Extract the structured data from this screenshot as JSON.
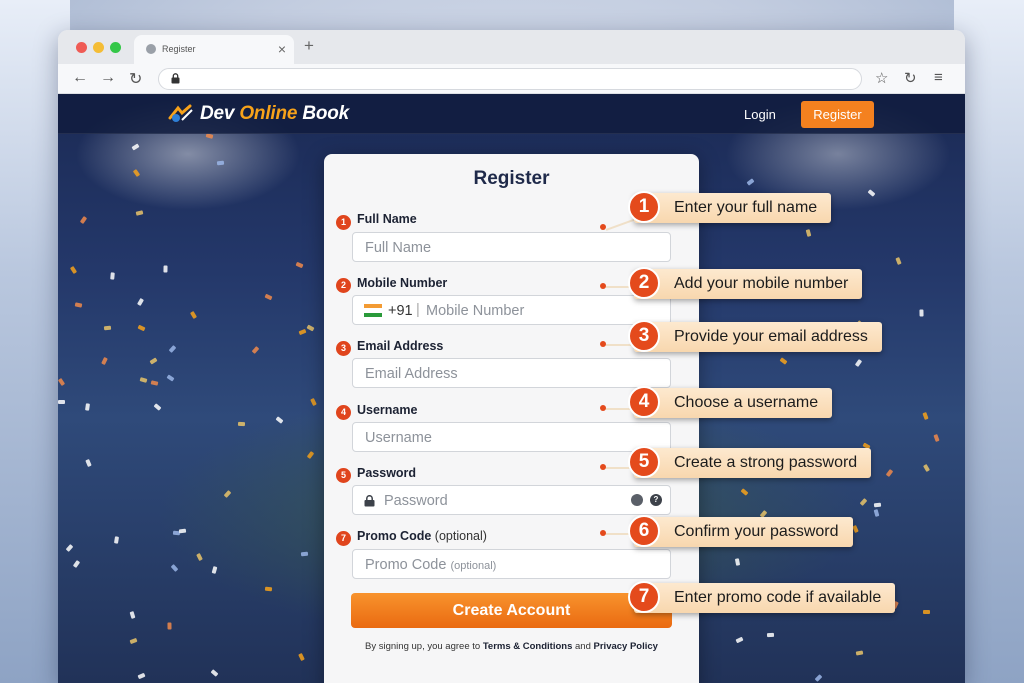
{
  "browser": {
    "tab_title": "Register",
    "new_tab_symbol": "+",
    "close_symbol": "×",
    "back_symbol": "←",
    "forward_symbol": "→",
    "reload_symbol": "↻",
    "star_symbol": "☆",
    "menu_symbol": "≡"
  },
  "header": {
    "brand_part1": "Dev ",
    "brand_part2": "Online",
    "brand_part3": " Book",
    "login_label": "Login",
    "register_label": "Register"
  },
  "form": {
    "title": "Register",
    "fields": [
      {
        "step": "1",
        "label": "Full Name",
        "placeholder": "Full Name"
      },
      {
        "step": "2",
        "label": "Mobile Number",
        "country_code": "+91",
        "separator": "|",
        "placeholder": "Mobile Number"
      },
      {
        "step": "3",
        "label": "Email Address",
        "placeholder": "Email Address"
      },
      {
        "step": "4",
        "label": "Username",
        "placeholder": "Username"
      },
      {
        "step": "5",
        "label": "Password",
        "placeholder": "Password"
      },
      {
        "step": "7",
        "label": "Promo Code",
        "label_note": "(optional)",
        "placeholder": "Promo Code",
        "placeholder_note": "(optional)"
      }
    ],
    "submit_label": "Create Account",
    "help_symbol": "?",
    "terms_prefix": "By signing up, you agree to ",
    "terms_link": "Terms & Conditions",
    "terms_and": " and ",
    "privacy_link": "Privacy Policy"
  },
  "callouts": [
    {
      "num": "1",
      "text": "Enter your full name"
    },
    {
      "num": "2",
      "text": "Add your mobile number"
    },
    {
      "num": "3",
      "text": "Provide your email address"
    },
    {
      "num": "4",
      "text": "Choose a username"
    },
    {
      "num": "5",
      "text": "Create a strong password"
    },
    {
      "num": "6",
      "text": "Confirm your password"
    },
    {
      "num": "7",
      "text": "Enter promo code if available"
    }
  ],
  "colors": {
    "accent": "#f4811f",
    "step_badge": "#e0451d",
    "callout_bg": "#fde9cf",
    "header_bg": "#101c3e"
  }
}
